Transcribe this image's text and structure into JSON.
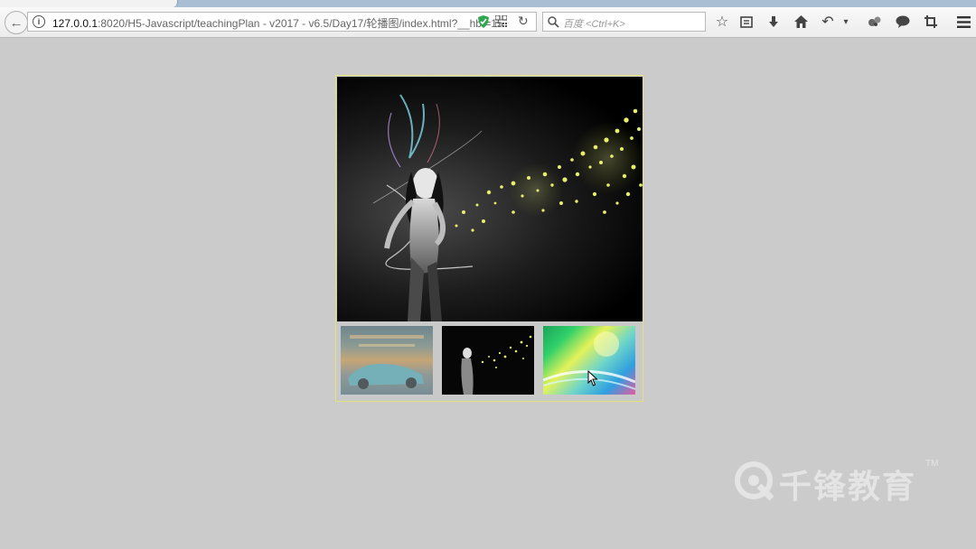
{
  "browser": {
    "tab_title": "",
    "url_host": "127.0.0.1",
    "url_rest": ":8020/H5-Javascript/teachingPlan - v2017 - v6.5/Day17/轮播图/index.html?__hbt=15",
    "search_placeholder": "百度 <Ctrl+K>",
    "toolbar_icons": [
      "bookmark-star-icon",
      "reading-list-icon",
      "download-icon",
      "home-icon",
      "undo-icon",
      "dropdown-icon",
      "extension-icon",
      "chat-icon",
      "crop-icon",
      "menu-icon"
    ]
  },
  "carousel": {
    "main_image": "woman-with-glowing-particles",
    "thumbnails": [
      {
        "name": "thumbnail-car-in-warehouse"
      },
      {
        "name": "thumbnail-woman-with-particles"
      },
      {
        "name": "thumbnail-rainbow-abstract"
      }
    ]
  },
  "watermark": {
    "text": "千锋教育",
    "tm": "TM"
  },
  "colors": {
    "page_background": "#cbcbcb",
    "carousel_border": "#e6e17a",
    "particles": "#e8ef6a"
  }
}
